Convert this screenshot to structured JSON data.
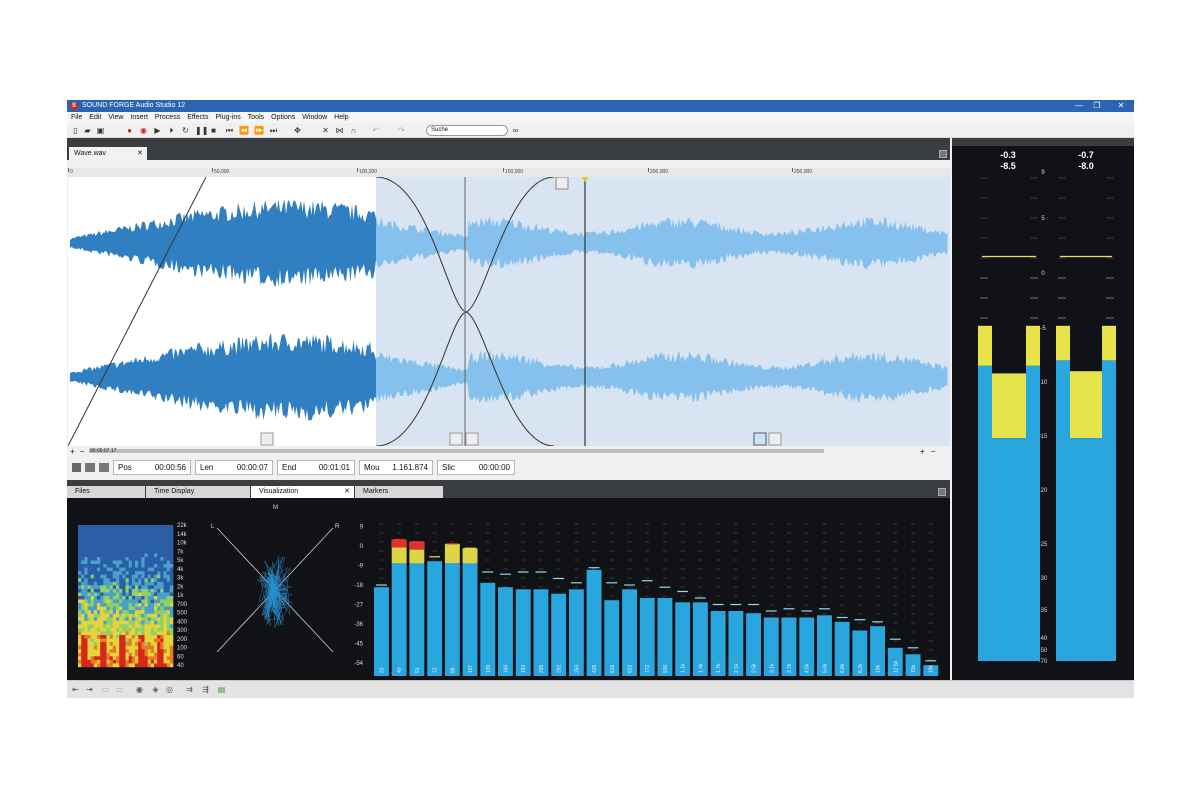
{
  "app": {
    "title": "SOUND FORGE Audio Studio 12",
    "logo_letter": "S"
  },
  "window": {
    "minimize": "—",
    "restore": "❐",
    "close": "✕"
  },
  "menu": [
    "File",
    "Edit",
    "View",
    "Insert",
    "Process",
    "Effects",
    "Plug-ins",
    "Tools",
    "Options",
    "Window",
    "Help"
  ],
  "toolbar": {
    "icons": [
      "new-file-icon",
      "open-folder-icon",
      "save-icon",
      "record-icon",
      "record-arm-icon",
      "play-icon",
      "play-all-icon",
      "loop-play-icon",
      "pause-icon",
      "stop-icon",
      "go-start-icon",
      "rewind-icon",
      "forward-icon",
      "go-end-icon",
      "snap-icon",
      "trim-icon",
      "crossfade-icon",
      "magnet-icon",
      "undo-icon",
      "redo-icon"
    ],
    "search_placeholder": "Suche"
  },
  "document": {
    "tab": "Wave.wav",
    "ruler_labels": [
      "0",
      "50,000",
      "100,000",
      "150,000",
      "200,000",
      "250,000"
    ],
    "selection_time": "00:00:07.17"
  },
  "status_fields": [
    {
      "label": "Pos",
      "value": "00:00:56"
    },
    {
      "label": "Len",
      "value": "00:00:07"
    },
    {
      "label": "End",
      "value": "00:01:01"
    },
    {
      "label": "Mou",
      "value": "1.161.874"
    },
    {
      "label": "Slic",
      "value": "00:00:00"
    }
  ],
  "panel_tabs": [
    "Files",
    "Time Display",
    "Visualization",
    "Markers"
  ],
  "panel_active": "Visualization",
  "spectrogram": {
    "freq_labels": [
      "22k",
      "14k",
      "10k",
      "7k",
      "5k",
      "4k",
      "3k",
      "2k",
      "1k",
      "700",
      "500",
      "400",
      "300",
      "200",
      "100",
      "60",
      "40"
    ]
  },
  "vectorscope": {
    "labels": [
      "M",
      "L",
      "R"
    ]
  },
  "spectrum": {
    "db_labels": [
      "9",
      "0",
      "-9",
      "-18",
      "-27",
      "-36",
      "-45",
      "-54"
    ],
    "colors": {
      "bar": "#2aa6de",
      "peak": "#e8e04a",
      "clip": "#e03030"
    },
    "bands": [
      {
        "label": "20",
        "level": -19,
        "peak": -18
      },
      {
        "label": "40",
        "level": -8,
        "peak": 3
      },
      {
        "label": "51",
        "level": -8,
        "peak": 2
      },
      {
        "label": "72",
        "level": -7,
        "peak": -5
      },
      {
        "label": "88",
        "level": -8,
        "peak": 1
      },
      {
        "label": "107",
        "level": -8,
        "peak": -1
      },
      {
        "label": "130",
        "level": -17,
        "peak": -12
      },
      {
        "label": "160",
        "level": -19,
        "peak": -13
      },
      {
        "label": "193",
        "level": -20,
        "peak": -12
      },
      {
        "label": "235",
        "level": -20,
        "peak": -12
      },
      {
        "label": "292",
        "level": -22,
        "peak": -15
      },
      {
        "label": "350",
        "level": -20,
        "peak": -17
      },
      {
        "label": "425",
        "level": -11,
        "peak": -10
      },
      {
        "label": "516",
        "level": -25,
        "peak": -17
      },
      {
        "label": "632",
        "level": -20,
        "peak": -18
      },
      {
        "label": "773",
        "level": -24,
        "peak": -16
      },
      {
        "label": "930",
        "level": -24,
        "peak": -19
      },
      {
        "label": "1.1k",
        "level": -26,
        "peak": -21
      },
      {
        "label": "1.4k",
        "level": -26,
        "peak": -24
      },
      {
        "label": "1.7k",
        "level": -30,
        "peak": -27
      },
      {
        "label": "2.1k",
        "level": -30,
        "peak": -27
      },
      {
        "label": "2.5k",
        "level": -31,
        "peak": -27
      },
      {
        "label": "3.1k",
        "level": -33,
        "peak": -30
      },
      {
        "label": "3.7k",
        "level": -33,
        "peak": -29
      },
      {
        "label": "4.5k",
        "level": -33,
        "peak": -30
      },
      {
        "label": "5.6k",
        "level": -32,
        "peak": -29
      },
      {
        "label": "6.8k",
        "level": -35,
        "peak": -33
      },
      {
        "label": "8.2k",
        "level": -39,
        "peak": -34
      },
      {
        "label": "10k",
        "level": -37,
        "peak": -35
      },
      {
        "label": "12.5k",
        "level": -47,
        "peak": -43
      },
      {
        "label": "15k",
        "level": -50,
        "peak": -47
      },
      {
        "label": "18k",
        "level": -55,
        "peak": -53
      }
    ]
  },
  "meters": {
    "peak_readouts": [
      "-0.3",
      "-0.7"
    ],
    "rms_readouts": [
      "-8.5",
      "-8.0"
    ],
    "scale": [
      "9",
      "5",
      "0",
      "-5",
      "-10",
      "-15",
      "-20",
      "-25",
      "-30",
      "-35",
      "-40",
      "-50",
      "-70"
    ],
    "channels": [
      {
        "rms": -8.5,
        "peak": -4.8,
        "level": -9.2
      },
      {
        "rms": -8.0,
        "peak": -4.8,
        "level": -9.0
      }
    ],
    "colors": {
      "rms": "#2aa6de",
      "peak": "#e7e34a"
    }
  }
}
